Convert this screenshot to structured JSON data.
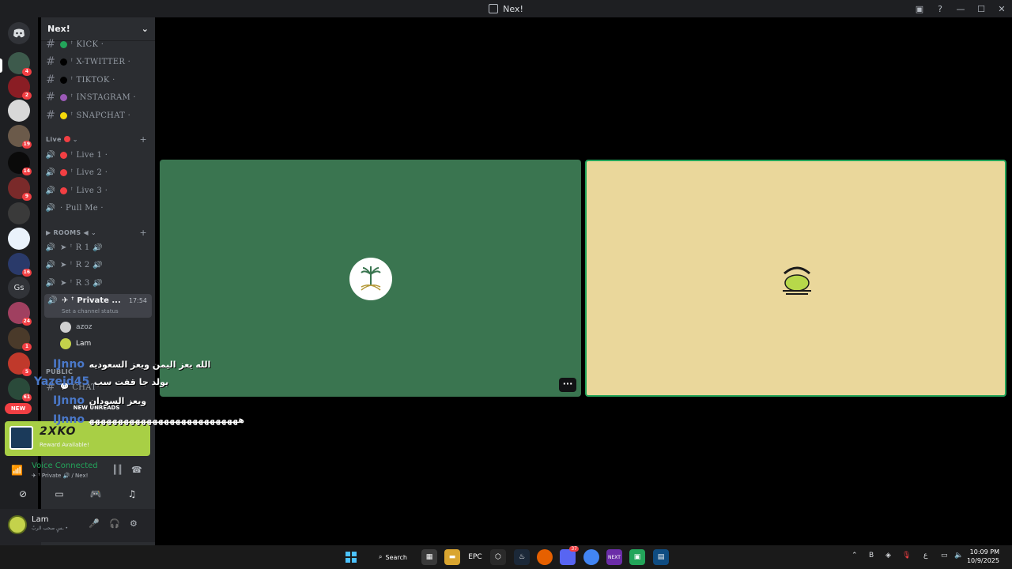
{
  "window": {
    "title": "Nex!"
  },
  "server": {
    "name": "Nex!"
  },
  "rail": {
    "badges": [
      "4",
      "2",
      "19",
      "14",
      "9",
      "16",
      "24",
      "1",
      "5",
      "61"
    ],
    "text_server": "Gs",
    "new_label": "NEW"
  },
  "channels": {
    "text": [
      {
        "label": "ꜛ KICK ·",
        "dot": "#23a55a"
      },
      {
        "label": "ꜛ X-TWITTER ·",
        "dot": "#000000"
      },
      {
        "label": "ꜛ TIKTOK ·",
        "dot": "#000000"
      },
      {
        "label": "ꜛ INSTAGRAM ·",
        "dot": "#9b59b6"
      },
      {
        "label": "ꜛ SNAPCHAT ·",
        "dot": "#f5d90a"
      }
    ],
    "live_category": "Live",
    "live": [
      {
        "label": "ꜛ Live 1 ·",
        "dot": "#f23f43"
      },
      {
        "label": "ꜛ Live 2 ·",
        "dot": "#f23f43"
      },
      {
        "label": "ꜛ Live 3 ·",
        "dot": "#f23f43"
      },
      {
        "label": "· Pull Me ·",
        "dot": ""
      }
    ],
    "rooms_category": "ROOMS ◀",
    "rooms": [
      "➤ ꜛ R 1 🔊",
      "➤ ꜛ R 2 🔊",
      "➤ ꜛ R 3 🔊"
    ],
    "active": {
      "label": "✈ ꜛ Private ...",
      "time": "17:54",
      "status_hint": "Set a channel status"
    },
    "members": [
      "azoz",
      "Lam"
    ],
    "public_category": "PUBLIC",
    "chat_label": "CHAT",
    "new_unreads": "NEW UNREADS"
  },
  "promo": {
    "brand": "2XKO",
    "reward": "Reward Available!"
  },
  "voice": {
    "status": "Voice Connected",
    "channel": "✈ ꜛ Private 🔊 / Nex!"
  },
  "user": {
    "name": "Lam",
    "status": "ـسٍ صحب الربٌ •"
  },
  "overlay": {
    "lines": [
      {
        "name": "IJnno",
        "msg": "الله يعز اليمن ويعز السعوديه"
      },
      {
        "name": "Yazeid45",
        "msg": "يولد جا قفت سب"
      },
      {
        "name": "IJnno",
        "msg": "ويعز السودان"
      },
      {
        "name": "IJnno",
        "msg": "ﻫﻬﻬﻬﻬﻬﻬﻬﻬﻬﻬﻬﻬﻬﻬﻬﻬﻬﻬﻬﻬﻬﻬﻬﻬﻬﻬ"
      }
    ]
  },
  "taskbar": {
    "search_label": "Search",
    "discord_badge": "37",
    "time": "10:09 PM",
    "date": "10/9/2025",
    "lang": "ع"
  }
}
